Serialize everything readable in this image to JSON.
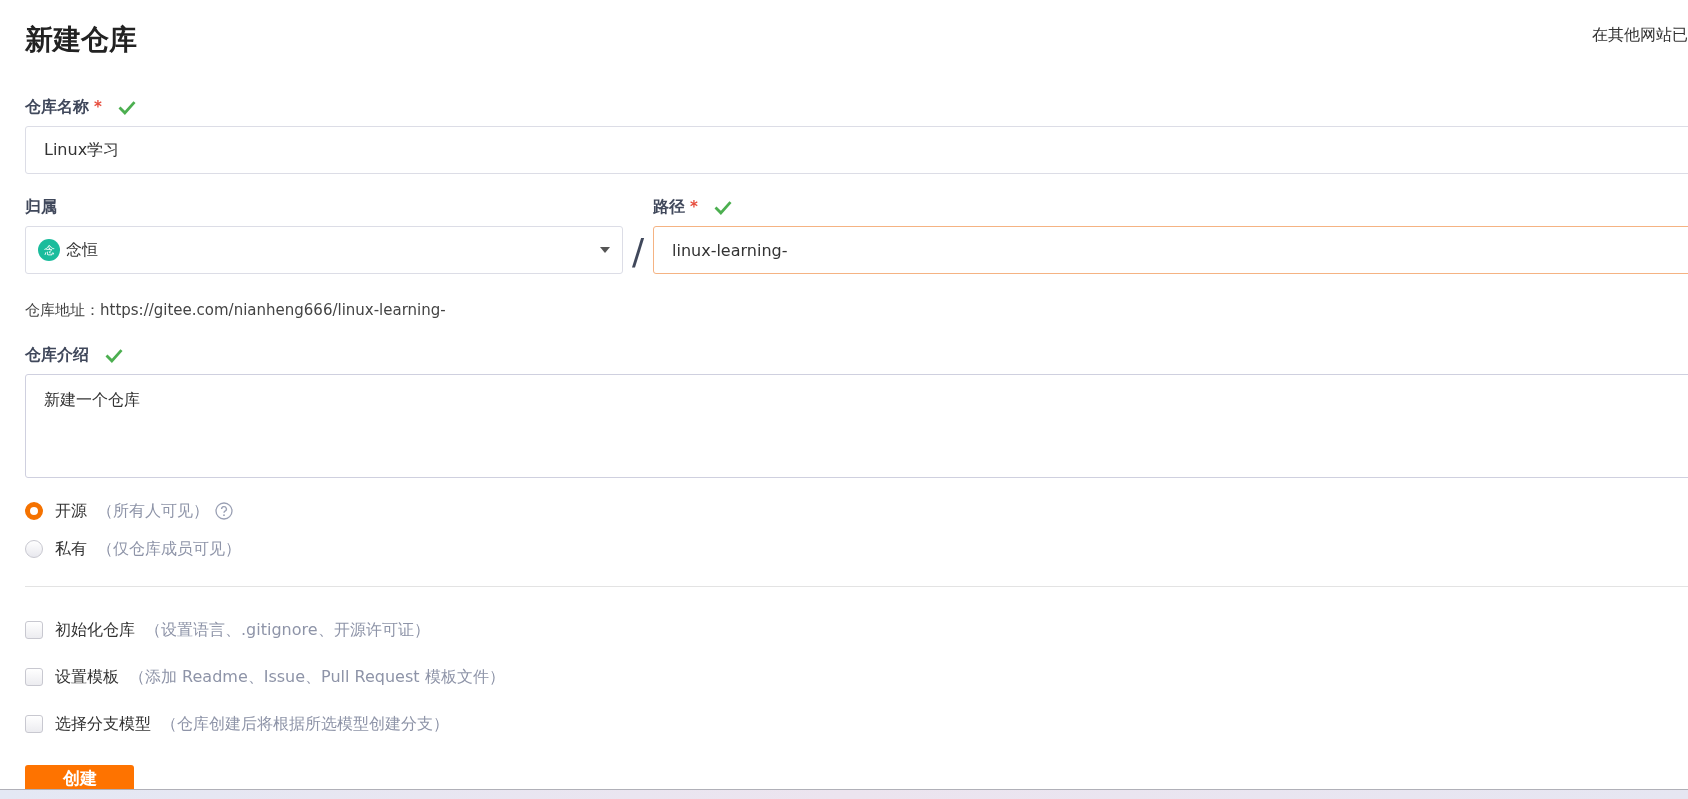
{
  "page": {
    "title": "新建仓库",
    "side_note": "在其他网站已"
  },
  "name_field": {
    "label": "仓库名称",
    "required_mark": "*",
    "valid": true,
    "value": "Linux学习"
  },
  "owner_field": {
    "label": "归属",
    "avatar": "念",
    "value": "念恒"
  },
  "separator": "/",
  "path_field": {
    "label": "路径",
    "required_mark": "*",
    "valid": true,
    "value": "linux-learning-",
    "focused": true
  },
  "address": {
    "label": "仓库地址：",
    "url": "https://gitee.com/nianheng666/linux-learning-"
  },
  "description_field": {
    "label": "仓库介绍",
    "valid": true,
    "value": "新建一个仓库"
  },
  "visibility": [
    {
      "label": "开源",
      "hint": "（所有人可见）",
      "help": true,
      "selected": true
    },
    {
      "label": "私有",
      "hint": "（仅仓库成员可见）",
      "help": false,
      "selected": false
    }
  ],
  "options": [
    {
      "label": "初始化仓库",
      "hint": "（设置语言、.gitignore、开源许可证）",
      "checked": false
    },
    {
      "label": "设置模板",
      "hint": "（添加 Readme、Issue、Pull Request 模板文件）",
      "checked": false
    },
    {
      "label": "选择分支模型",
      "hint": "（仓库创建后将根据所选模型创建分支）",
      "checked": false
    }
  ],
  "submit": "创建"
}
